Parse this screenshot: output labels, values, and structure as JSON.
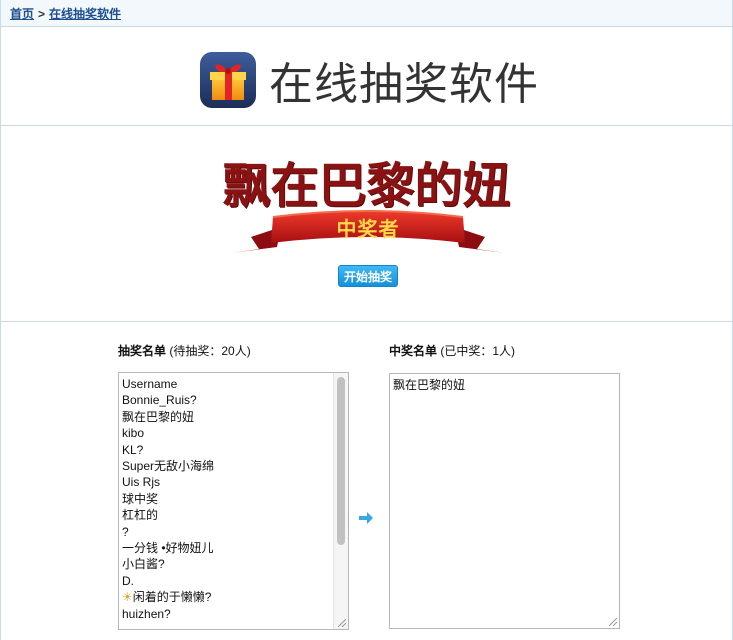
{
  "breadcrumb": {
    "home": "首页",
    "separator": ">",
    "current": "在线抽奖软件"
  },
  "header": {
    "title": "在线抽奖软件",
    "icon": "gift-box-icon"
  },
  "winner_display": {
    "name": "飘在巴黎的妞",
    "ribbon_text": "中奖者",
    "start_button": "开始抽奖"
  },
  "pending_list": {
    "label": "抽奖名单",
    "count_text": "(待抽奖：20人)",
    "entries": [
      "Username",
      "Bonnie_Ruis?",
      "飘在巴黎的妞",
      "kibo",
      "KL?",
      "Super无敌小海绵",
      "Uis Rjs",
      "球中奖",
      "杠杠的",
      "?",
      "一分钱 •好物妞儿",
      "小白酱?",
      "D.",
      "闲着的于懒懒?",
      "huizhen?"
    ],
    "sun_emoji_entry_index": 13
  },
  "winner_list": {
    "label": "中奖名单",
    "count_text": "(已中奖：1人)",
    "entries": [
      "飘在巴黎的妞"
    ]
  },
  "colors": {
    "link": "#1d4e8f",
    "winner_name": "#8b1212",
    "ribbon_red": "#c4161c",
    "ribbon_text": "#ffd94a",
    "button_blue": "#1d9be3",
    "border": "#c9dbe8"
  }
}
